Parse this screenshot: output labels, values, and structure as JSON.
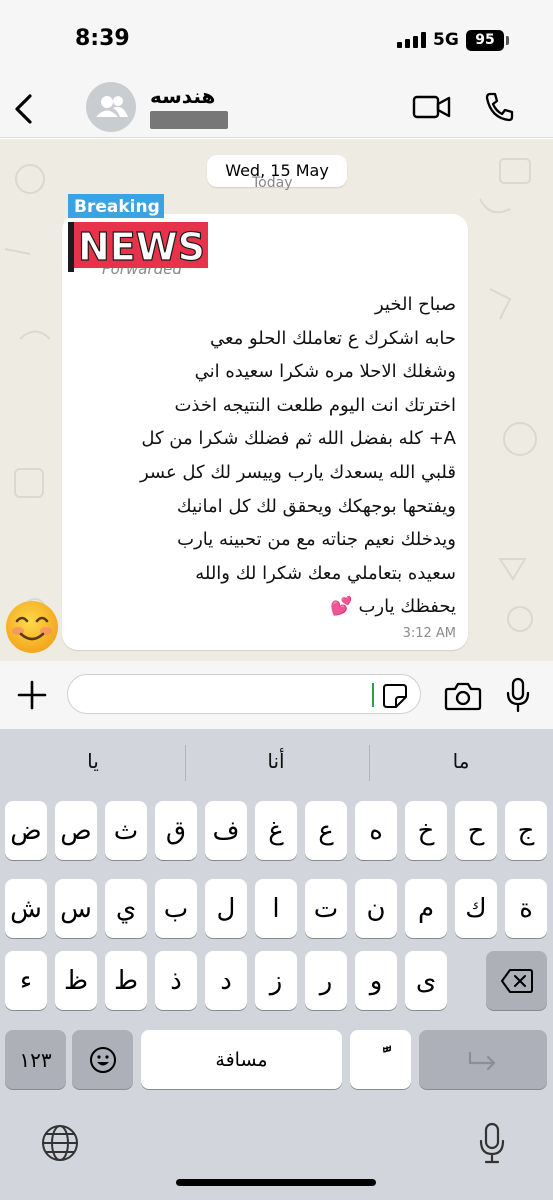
{
  "status_bar": {
    "time": "8:39",
    "network": "5G",
    "battery": "95"
  },
  "header": {
    "contact_name": "هندسه"
  },
  "chat": {
    "date_label": "Wed, 15 May",
    "today_label": "Today",
    "message": {
      "image_text_top": "Breaking",
      "image_text_bottom": "NEWS",
      "forwarded_label": "Forwarded",
      "lines": [
        "صباح الخير",
        "حابه اشكرك ع تعاملك الحلو معي",
        "وشغلك الاحلا مره شكرا سعيده اني",
        "اخترتك انت اليوم طلعت النتيجه اخذت",
        "A+ كله بفضل الله ثم فضلك شكرا من كل",
        "قلبي الله يسعدك يارب وييسر لك كل عسر",
        "ويفتحها بوجهكك ويحقق لك كل امانيك",
        "ويدخلك نعيم جناته مع من تحبينه يارب",
        "سعيده بتعاملي معك شكرا لك والله",
        "يحفظك يارب 💕"
      ],
      "time": "3:12 AM"
    }
  },
  "input": {
    "placeholder": ""
  },
  "keyboard": {
    "suggestions": [
      "يا",
      "أنا",
      "ما"
    ],
    "row1": [
      "ض",
      "ص",
      "ث",
      "ق",
      "ف",
      "غ",
      "ع",
      "ه",
      "خ",
      "ح",
      "ج"
    ],
    "row2": [
      "ش",
      "س",
      "ي",
      "ب",
      "ل",
      "ا",
      "ت",
      "ن",
      "م",
      "ك",
      "ة"
    ],
    "row3": [
      "ء",
      "ظ",
      "ط",
      "ذ",
      "د",
      "ز",
      "ر",
      "و",
      "ى"
    ],
    "numbers_key": "١٢٣",
    "space_key": "مسافة",
    "tanween_key": "ًّ"
  },
  "colors": {
    "accent_green": "#25a24f",
    "news_red": "#e8324c",
    "news_blue": "#3aa3e3",
    "heart_pink": "#f24f9b"
  }
}
